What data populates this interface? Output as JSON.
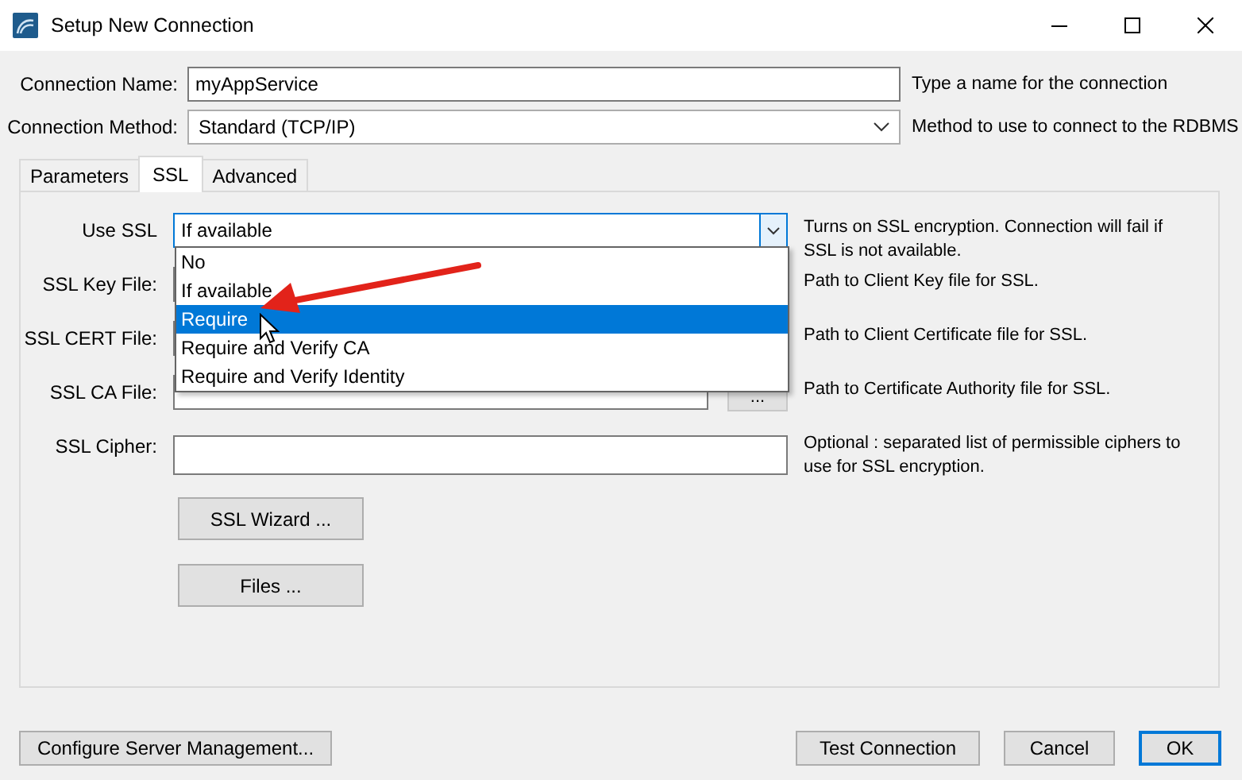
{
  "window": {
    "title": "Setup New Connection"
  },
  "connection_name": {
    "label": "Connection Name:",
    "value": "myAppService",
    "hint": "Type a name for the connection"
  },
  "connection_method": {
    "label": "Connection Method:",
    "value": "Standard (TCP/IP)",
    "hint": "Method to use to connect to the RDBMS"
  },
  "tabs": [
    {
      "label": "Parameters",
      "selected": false
    },
    {
      "label": "SSL",
      "selected": true
    },
    {
      "label": "Advanced",
      "selected": false
    }
  ],
  "ssl_panel": {
    "fields": [
      {
        "kind": "dropdown",
        "label": "Use SSL",
        "value": "If available",
        "hint": "Turns on SSL encryption. Connection will fail if SSL is not available.",
        "expanded": true,
        "options": [
          {
            "label": "No",
            "highlighted": false
          },
          {
            "label": "If available",
            "highlighted": false
          },
          {
            "label": "Require",
            "highlighted": true
          },
          {
            "label": "Require and Verify CA",
            "highlighted": false
          },
          {
            "label": "Require and Verify Identity",
            "highlighted": false
          }
        ]
      },
      {
        "kind": "file",
        "label": "SSL Key File:",
        "hint": "Path to Client Key file for SSL."
      },
      {
        "kind": "file",
        "label": "SSL CERT File:",
        "hint": "Path to Client Certificate file for SSL."
      },
      {
        "kind": "file",
        "label": "SSL CA File:",
        "hint": "Path to Certificate Authority file for SSL.",
        "browse": "..."
      },
      {
        "kind": "text",
        "label": "SSL Cipher:",
        "hint": "Optional : separated list of permissible ciphers to use for SSL encryption."
      }
    ],
    "buttons": [
      "SSL Wizard ...",
      "Files ..."
    ]
  },
  "footer": {
    "left_button": "Configure Server Management...",
    "buttons": [
      {
        "label": "Test Connection",
        "default": false
      },
      {
        "label": "Cancel",
        "default": false
      },
      {
        "label": "OK",
        "default": true
      }
    ]
  }
}
